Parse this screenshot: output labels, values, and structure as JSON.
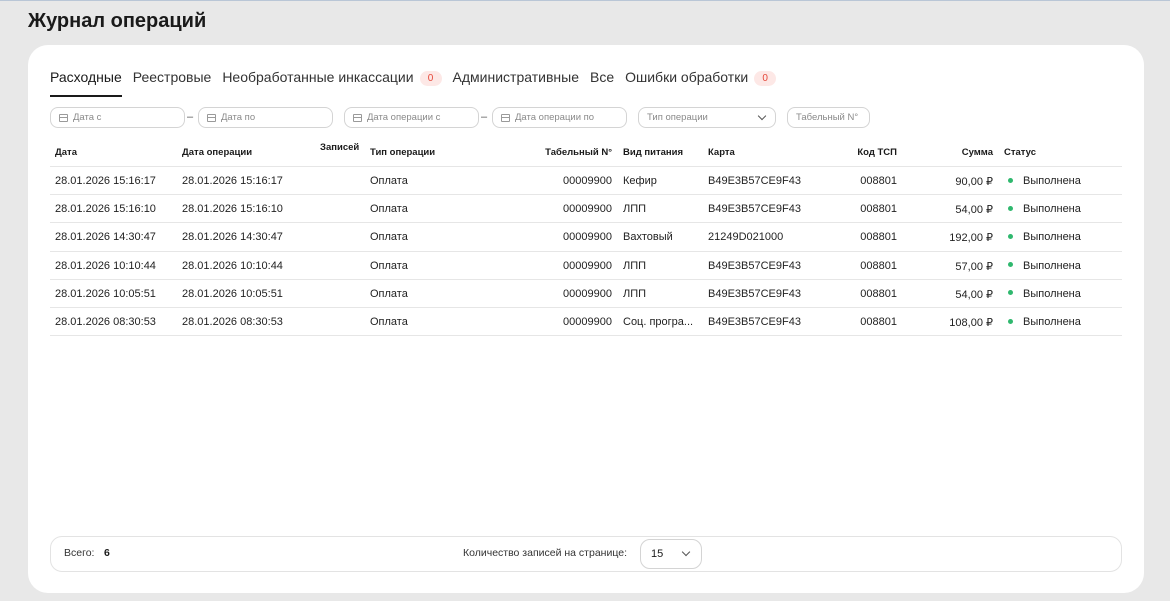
{
  "page": {
    "title": "Журнал операций"
  },
  "tabs": [
    {
      "label": "Расходные",
      "active": true
    },
    {
      "label": "Реестровые"
    },
    {
      "label": "Необработанные инкассации",
      "badge": "0"
    },
    {
      "label": "Административные"
    },
    {
      "label": "Все"
    },
    {
      "label": "Ошибки обработки",
      "badge": "0"
    }
  ],
  "filters": {
    "date_from": "Дата с",
    "date_to": "Дата по",
    "op_date_from": "Дата операции с",
    "op_date_to": "Дата операции по",
    "op_type": "Тип операции",
    "tab_no": "Табельный N°"
  },
  "columns": {
    "date": "Дата",
    "op_date": "Дата операции",
    "records": "Записей",
    "op_type": "Тип операции",
    "tab_no": "Табельный N°",
    "food_type": "Вид питания",
    "card": "Карта",
    "tsp": "Код ТСП",
    "sum": "Сумма",
    "status": "Статус"
  },
  "rows": [
    {
      "date": "28.01.2026 15:16:17",
      "op_date": "28.01.2026 15:16:17",
      "records": "",
      "op_type": "Оплата",
      "tab_no": "00009900",
      "food_type": "Кефир",
      "card": "B49E3B57CE9F43",
      "tsp": "008801",
      "sum": "90,00 ₽",
      "status": "Выполнена"
    },
    {
      "date": "28.01.2026 15:16:10",
      "op_date": "28.01.2026 15:16:10",
      "records": "",
      "op_type": "Оплата",
      "tab_no": "00009900",
      "food_type": "ЛПП",
      "card": "B49E3B57CE9F43",
      "tsp": "008801",
      "sum": "54,00 ₽",
      "status": "Выполнена"
    },
    {
      "date": "28.01.2026 14:30:47",
      "op_date": "28.01.2026 14:30:47",
      "records": "",
      "op_type": "Оплата",
      "tab_no": "00009900",
      "food_type": "Вахтовый",
      "card": "21249D021000",
      "tsp": "008801",
      "sum": "192,00 ₽",
      "status": "Выполнена"
    },
    {
      "date": "28.01.2026 10:10:44",
      "op_date": "28.01.2026 10:10:44",
      "records": "",
      "op_type": "Оплата",
      "tab_no": "00009900",
      "food_type": "ЛПП",
      "card": "B49E3B57CE9F43",
      "tsp": "008801",
      "sum": "57,00 ₽",
      "status": "Выполнена"
    },
    {
      "date": "28.01.2026 10:05:51",
      "op_date": "28.01.2026 10:05:51",
      "records": "",
      "op_type": "Оплата",
      "tab_no": "00009900",
      "food_type": "ЛПП",
      "card": "B49E3B57CE9F43",
      "tsp": "008801",
      "sum": "54,00 ₽",
      "status": "Выполнена"
    },
    {
      "date": "28.01.2026 08:30:53",
      "op_date": "28.01.2026 08:30:53",
      "records": "",
      "op_type": "Оплата",
      "tab_no": "00009900",
      "food_type": "Соц. програ...",
      "card": "B49E3B57CE9F43",
      "tsp": "008801",
      "sum": "108,00 ₽",
      "status": "Выполнена"
    }
  ],
  "footer": {
    "total_label": "Всего:",
    "total_value": "6",
    "per_page_label": "Количество записей на странице:",
    "per_page_value": "15"
  },
  "colors": {
    "status_ok": "#2fb86e",
    "badge_bg": "#fde8e6",
    "badge_text": "#e5483a"
  }
}
